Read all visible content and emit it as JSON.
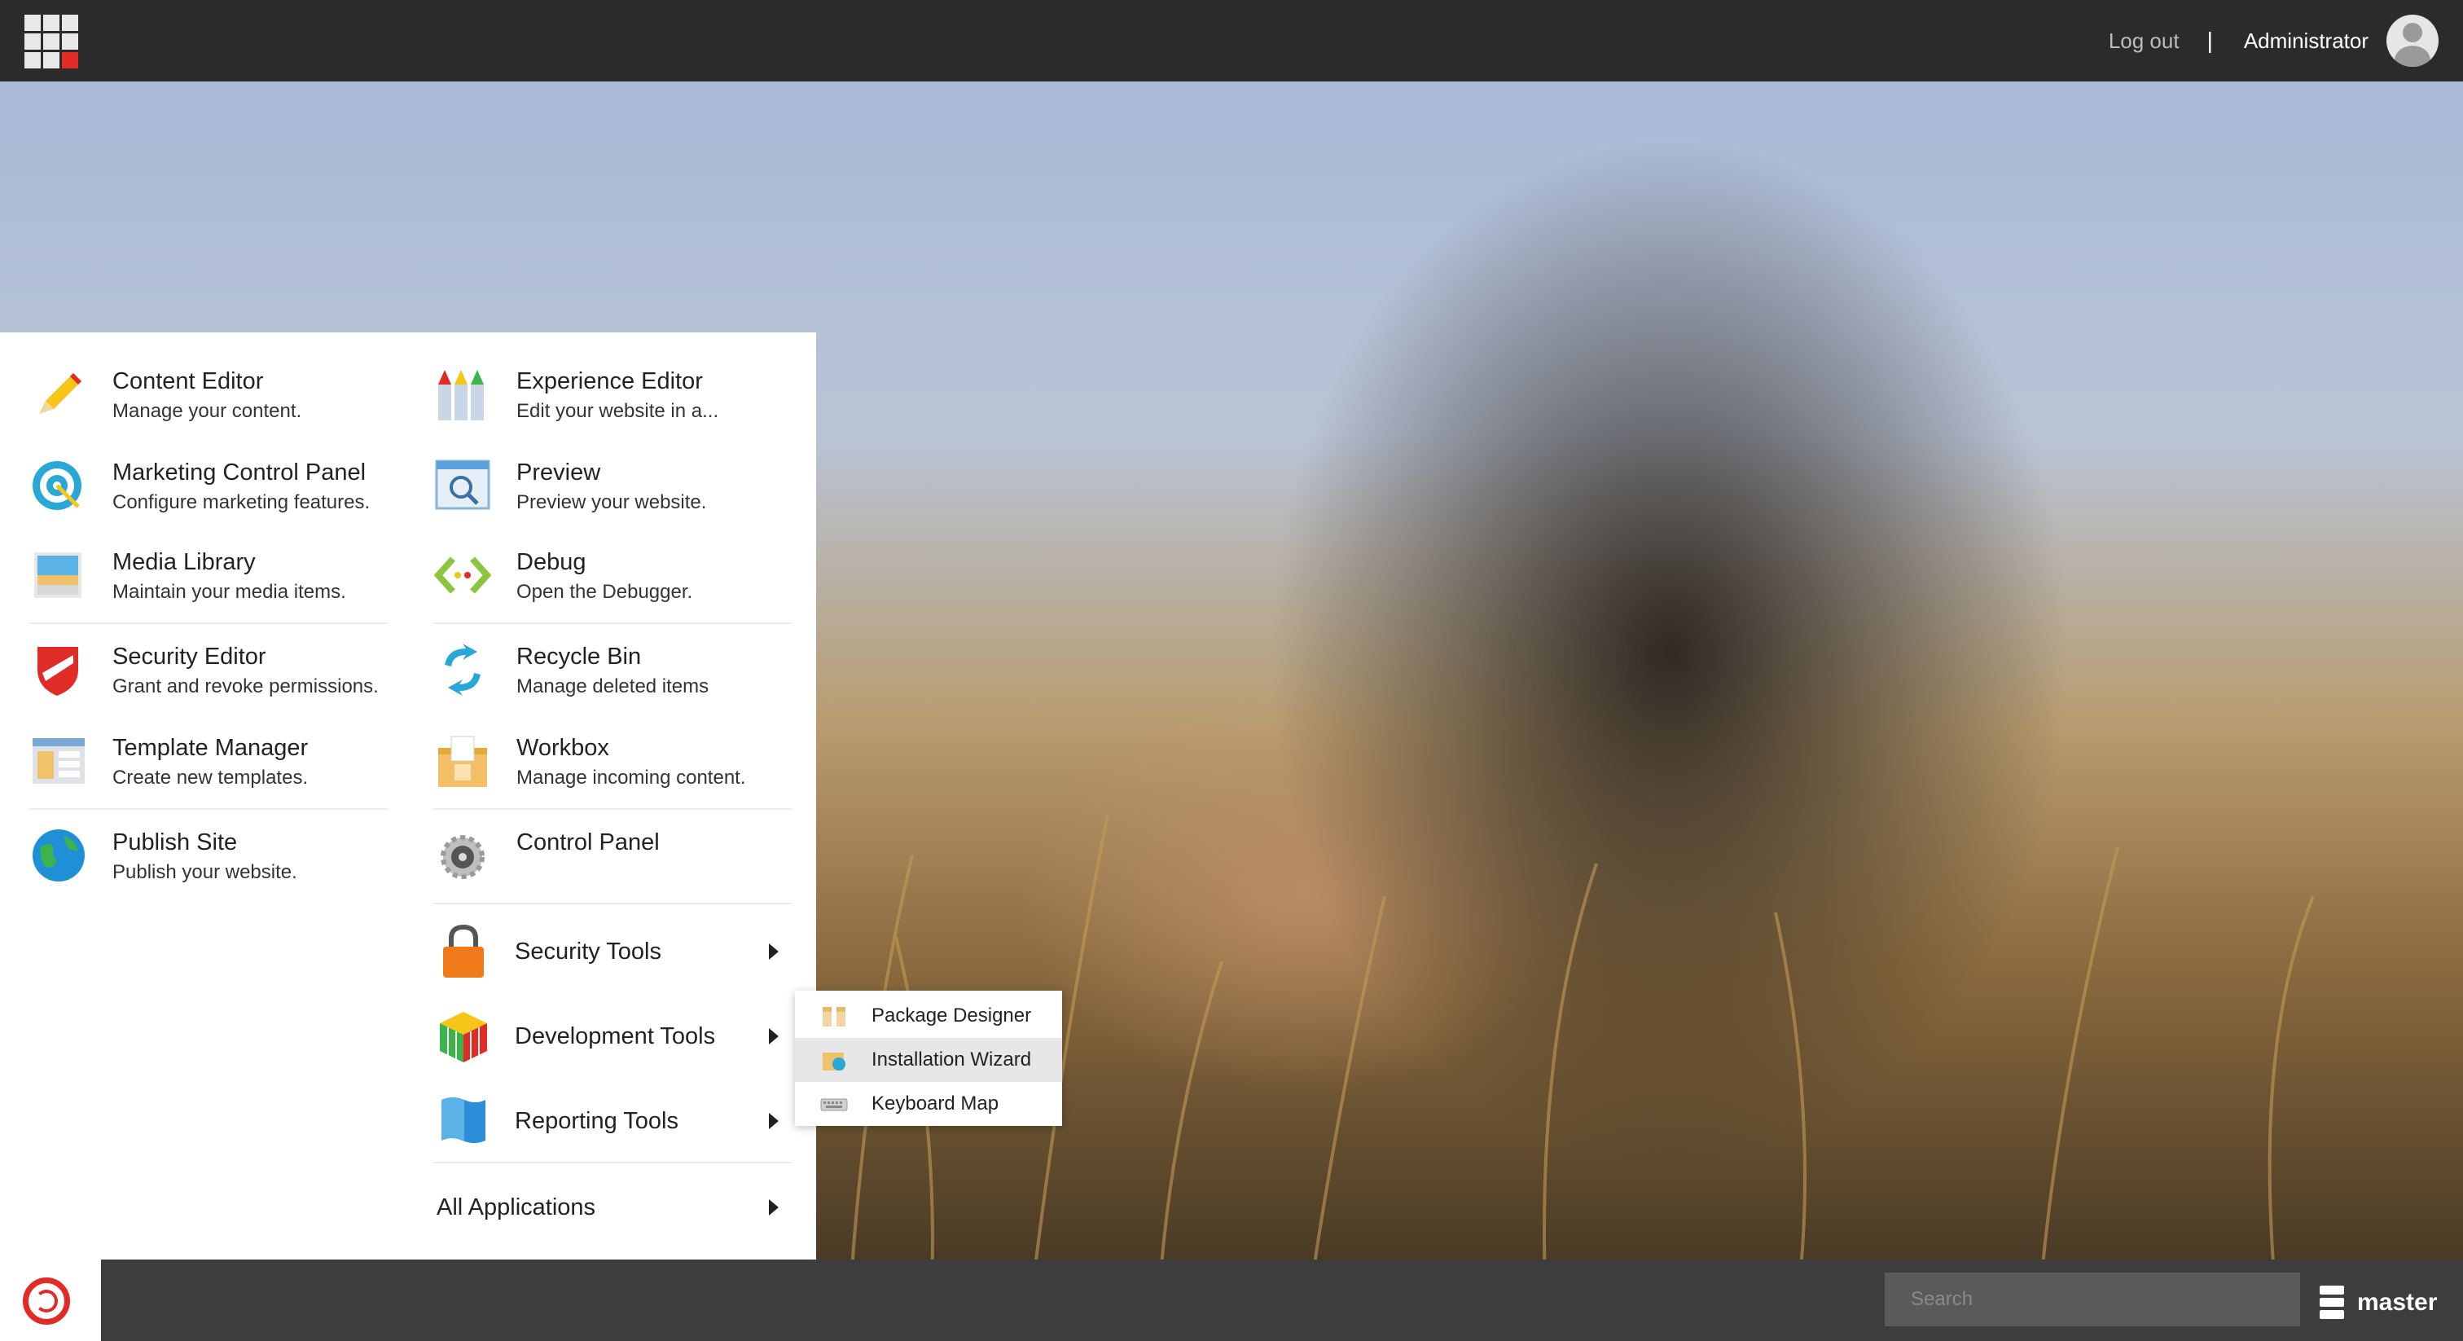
{
  "header": {
    "logout_label": "Log out",
    "separator": "|",
    "user_name": "Administrator"
  },
  "apps_left": [
    {
      "name": "Content Editor",
      "desc": "Manage your content.",
      "icon": "pencil-icon"
    },
    {
      "name": "Marketing Control Panel",
      "desc": "Configure marketing features.",
      "icon": "target-icon"
    },
    {
      "name": "Media Library",
      "desc": "Maintain your media items.",
      "icon": "media-icon"
    },
    {
      "name": "Security Editor",
      "desc": "Grant and revoke permissions.",
      "icon": "shield-icon"
    },
    {
      "name": "Template Manager",
      "desc": "Create new templates.",
      "icon": "template-icon"
    },
    {
      "name": "Publish Site",
      "desc": "Publish your website.",
      "icon": "globe-icon"
    }
  ],
  "apps_right": [
    {
      "name": "Experience Editor",
      "desc": "Edit your website in a...",
      "icon": "crayons-icon"
    },
    {
      "name": "Preview",
      "desc": "Preview your website.",
      "icon": "magnifier-window-icon"
    },
    {
      "name": "Debug",
      "desc": "Open the Debugger.",
      "icon": "debug-icon"
    },
    {
      "name": "Recycle Bin",
      "desc": "Manage deleted items",
      "icon": "recycle-icon"
    },
    {
      "name": "Workbox",
      "desc": "Manage incoming content.",
      "icon": "workbox-icon"
    },
    {
      "name": "Control Panel",
      "icon": "gear-icon"
    }
  ],
  "tools": [
    {
      "name": "Security Tools",
      "icon": "lock-icon"
    },
    {
      "name": "Development Tools",
      "icon": "cube-icon"
    },
    {
      "name": "Reporting Tools",
      "icon": "report-icon"
    }
  ],
  "all_applications": "All Applications",
  "submenu": [
    {
      "name": "Package Designer",
      "icon": "package-icon"
    },
    {
      "name": "Installation Wizard",
      "icon": "install-icon",
      "active": true
    },
    {
      "name": "Keyboard Map",
      "icon": "keyboard-icon"
    }
  ],
  "bottom": {
    "search_placeholder": "Search",
    "database": "master"
  },
  "colors": {
    "topbar": "#2b2b2b",
    "bottombar": "#3d3d3d",
    "accent_red": "#e02b27"
  }
}
